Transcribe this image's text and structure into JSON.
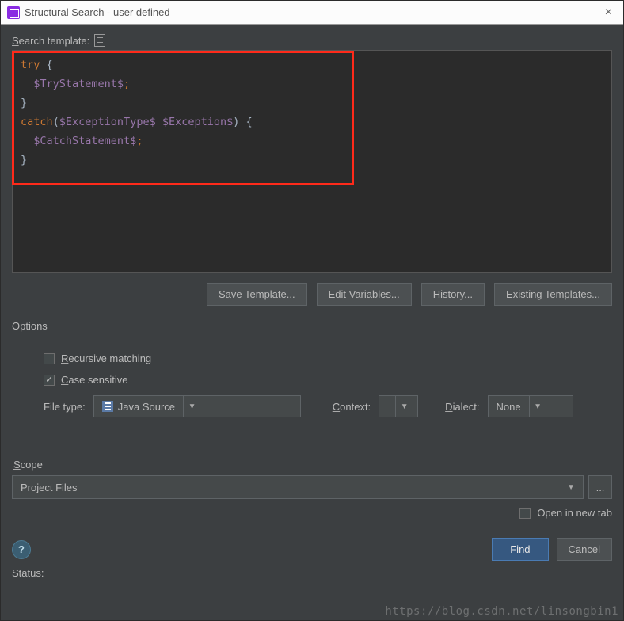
{
  "window": {
    "title": "Structural Search - user defined"
  },
  "template": {
    "label_prefix": "S",
    "label_rest": "earch template:"
  },
  "code": {
    "line1_kw": "try",
    "line1_brace": " {",
    "line2_indent": "  ",
    "line2_var": "$TryStatement$",
    "line2_semi": ";",
    "line3": "}",
    "line4_kw": "catch",
    "line4_open": "(",
    "line4_var1": "$ExceptionType$",
    "line4_sp": " ",
    "line4_var2": "$Exception$",
    "line4_close": ")",
    "line4_brace": " {",
    "line5_indent": "  ",
    "line5_var": "$CatchStatement$",
    "line5_semi": ";",
    "line6": "}"
  },
  "buttons": {
    "save_template": "Save Template...",
    "edit_variables_pre": "E",
    "edit_variables_mid": "dit Variables...",
    "history_pre": "H",
    "history_mid": "istory...",
    "existing_pre": "E",
    "existing_mid": "xisting Templates...",
    "save_pre": "S",
    "save_mid": "ave Template..."
  },
  "options": {
    "legend": "Options",
    "recursive_pre": "R",
    "recursive_rest": "ecursive matching",
    "case_pre": "C",
    "case_rest": "ase sensitive",
    "filetype_label": "File type:",
    "filetype_value": "Java Source",
    "context_pre": "C",
    "context_rest": "ontext:",
    "context_value": "",
    "dialect_pre": "D",
    "dialect_rest": "ialect:",
    "dialect_value": "None"
  },
  "scope": {
    "label_pre": "S",
    "label_rest": "cope",
    "value": "Project Files",
    "open_new_tab": "Open in new tab"
  },
  "footer": {
    "find": "Find",
    "cancel": "Cancel",
    "status": "Status:"
  },
  "watermark": "https://blog.csdn.net/linsongbin1"
}
